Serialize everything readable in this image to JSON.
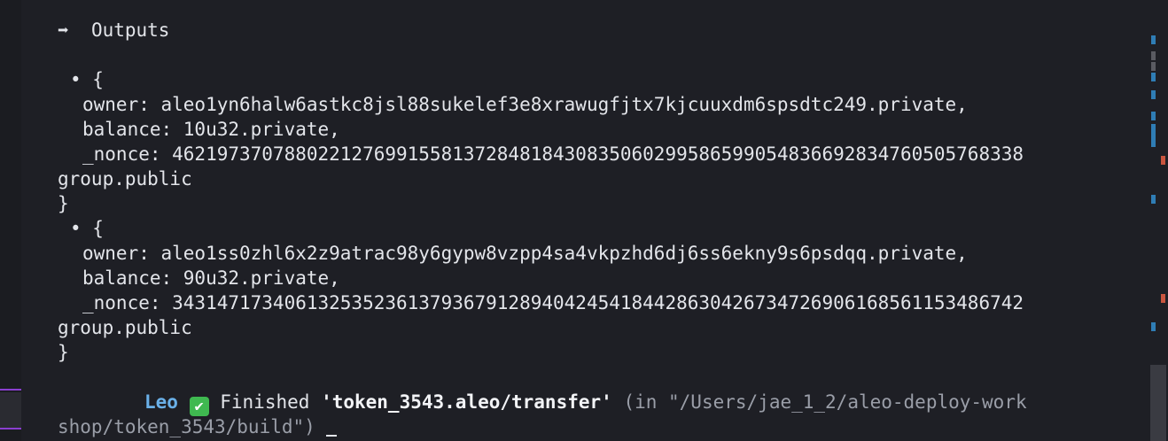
{
  "terminal": {
    "outputs_heading": {
      "arrow": "➡",
      "label": "Outputs"
    },
    "records": [
      {
        "bullet": "• {",
        "owner_line": "owner: aleo1yn6halw6astkc8jsl88sukelef3e8xrawugfjtx7kjcuuxdm6spsdtc249.private,",
        "balance_line": "balance: 10u32.private,",
        "nonce_line": "_nonce: 4621973707880221276991558137284818430835060299586599054836692834760505768338",
        "nonce_cont": "group.public",
        "close": "}"
      },
      {
        "bullet": "• {",
        "owner_line": "owner: aleo1ss0zhl6x2z9atrac98y6gypw8vzpp4sa4vkpzhd6dj6ss6ekny9s6psdqq.private,",
        "balance_line": "balance: 90u32.private,",
        "nonce_line": "_nonce: 3431471734061325352361379367912894042454184428630426734726906168561153486742",
        "nonce_cont": "group.public",
        "close": "}"
      }
    ],
    "status": {
      "app_name": "Leo",
      "check_glyph": "✔",
      "finished_label": "Finished",
      "program": "'token_3543.aleo/transfer'",
      "path_line1": "(in \"/Users/jae_1_2/aleo-deploy-work",
      "path_line2": "shop/token_3543/build\")"
    }
  },
  "colors": {
    "background": "#1e1f25",
    "text": "#e3e5ea",
    "leo_blue": "#6ab0e8",
    "check_green": "#3fb950",
    "dim": "#9a9ea8",
    "marker_blue": "#2f7db5",
    "marker_red": "#c9553f",
    "gutter_purple": "#8a3fd0"
  }
}
